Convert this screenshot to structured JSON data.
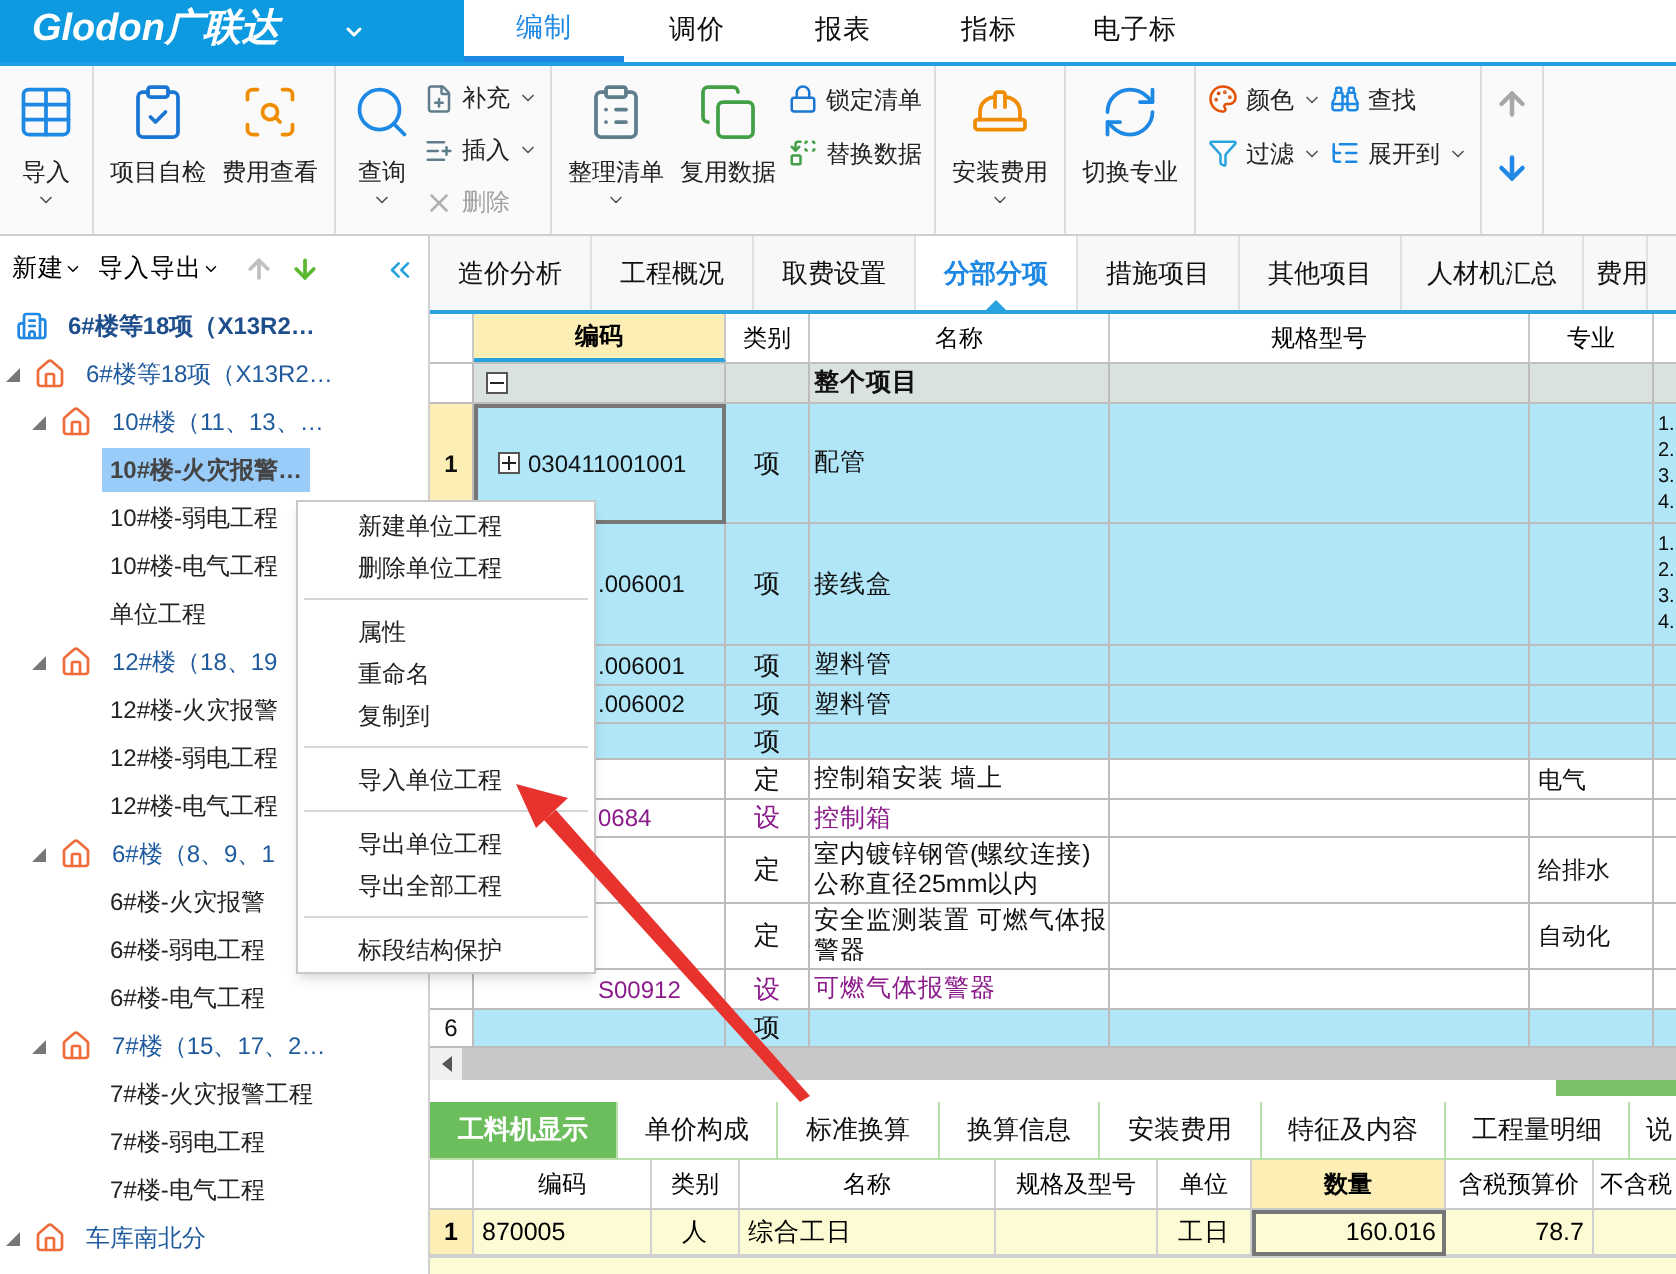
{
  "logo": "Glodon广联达",
  "main_tabs": [
    {
      "label": "编制",
      "selected": true
    },
    {
      "label": "调价",
      "selected": false
    },
    {
      "label": "报表",
      "selected": false
    },
    {
      "label": "指标",
      "selected": false
    },
    {
      "label": "电子标",
      "selected": false
    }
  ],
  "ribbon": {
    "groups": [
      {
        "columns": [
          [
            {
              "kind": "large",
              "label": "导入",
              "dropdown": true,
              "disabled": false
            }
          ]
        ]
      },
      {
        "columns": [
          [
            {
              "kind": "large",
              "label": "项目自检",
              "dropdown": false,
              "disabled": false
            }
          ],
          [
            {
              "kind": "large",
              "label": "费用查看",
              "dropdown": false,
              "disabled": false
            }
          ]
        ]
      },
      {
        "columns": [
          [
            {
              "kind": "large",
              "label": "查询",
              "dropdown": true,
              "disabled": false
            }
          ],
          [
            {
              "kind": "small",
              "label": "补充",
              "dropdown": true,
              "disabled": false
            },
            {
              "kind": "small",
              "label": "插入",
              "dropdown": true,
              "disabled": false
            },
            {
              "kind": "small",
              "label": "删除",
              "dropdown": false,
              "disabled": true
            }
          ]
        ]
      },
      {
        "columns": [
          [
            {
              "kind": "large",
              "label": "整理清单",
              "dropdown": true,
              "disabled": false
            }
          ],
          [
            {
              "kind": "large",
              "label": "复用数据",
              "dropdown": false,
              "disabled": false
            }
          ],
          [
            {
              "kind": "small",
              "label": "锁定清单",
              "dropdown": false,
              "disabled": false
            },
            {
              "kind": "small",
              "label": "替换数据",
              "dropdown": false,
              "disabled": false
            }
          ]
        ]
      },
      {
        "columns": [
          [
            {
              "kind": "large",
              "label": "安装费用",
              "dropdown": true,
              "disabled": false
            }
          ]
        ]
      },
      {
        "columns": [
          [
            {
              "kind": "large",
              "label": "切换专业",
              "dropdown": false,
              "disabled": false
            }
          ]
        ]
      },
      {
        "columns": [
          [
            {
              "kind": "small",
              "label": "颜色",
              "dropdown": true,
              "disabled": false
            },
            {
              "kind": "small",
              "label": "过滤",
              "dropdown": true,
              "disabled": false
            }
          ],
          [
            {
              "kind": "small",
              "label": "查找",
              "dropdown": false,
              "disabled": false
            },
            {
              "kind": "small",
              "label": "展开到",
              "dropdown": true,
              "disabled": false
            }
          ]
        ]
      },
      {
        "columns": [
          [
            {
              "kind": "arrow",
              "disabled": true
            },
            {
              "kind": "arrow",
              "disabled": false
            }
          ]
        ]
      }
    ]
  },
  "left_toolbar": {
    "new": "新建",
    "import_export": "导入导出",
    "move_up_disabled": true,
    "move_down_disabled": false
  },
  "tree": [
    {
      "label": "6#楼等18项（X13R2…",
      "selected": false,
      "children": [
        {
          "label": "6#楼等18项（X13R2…",
          "selected": false,
          "expanded": true,
          "children": [
            {
              "label": "10#楼（11、13、…",
              "selected": false,
              "expanded": true,
              "children": [
                {
                  "label": "10#楼-火灾报警…",
                  "selected": true
                },
                {
                  "label": "10#楼-弱电工程",
                  "selected": false
                },
                {
                  "label": "10#楼-电气工程",
                  "selected": false
                },
                {
                  "label": "单位工程",
                  "selected": false
                }
              ]
            },
            {
              "label": "12#楼（18、19",
              "selected": false,
              "expanded": true,
              "children": [
                {
                  "label": "12#楼-火灾报警",
                  "selected": false
                },
                {
                  "label": "12#楼-弱电工程",
                  "selected": false
                },
                {
                  "label": "12#楼-电气工程",
                  "selected": false
                }
              ]
            },
            {
              "label": "6#楼（8、9、1",
              "selected": false,
              "expanded": true,
              "children": [
                {
                  "label": "6#楼-火灾报警",
                  "selected": false
                },
                {
                  "label": "6#楼-弱电工程",
                  "selected": false
                },
                {
                  "label": "6#楼-电气工程",
                  "selected": false
                }
              ]
            },
            {
              "label": "7#楼（15、17、2…",
              "selected": false,
              "expanded": true,
              "children": [
                {
                  "label": "7#楼-火灾报警工程",
                  "selected": false
                },
                {
                  "label": "7#楼-弱电工程",
                  "selected": false
                },
                {
                  "label": "7#楼-电气工程",
                  "selected": false
                }
              ]
            }
          ]
        },
        {
          "label": "车库南北分",
          "selected": false,
          "expanded": true
        }
      ]
    }
  ],
  "page_tabs": [
    {
      "label": "造价分析",
      "selected": false
    },
    {
      "label": "工程概况",
      "selected": false
    },
    {
      "label": "取费设置",
      "selected": false
    },
    {
      "label": "分部分项",
      "selected": true
    },
    {
      "label": "措施项目",
      "selected": false
    },
    {
      "label": "其他项目",
      "selected": false
    },
    {
      "label": "人材机汇总",
      "selected": false
    },
    {
      "label": "费用",
      "selected": false
    }
  ],
  "grid": {
    "columns": [
      "编码",
      "类别",
      "名称",
      "规格型号",
      "专业"
    ],
    "rows": [
      {
        "kind": "group",
        "name": "整个项目",
        "selected": false
      },
      {
        "kind": "item",
        "num": "1",
        "code": "030411001001",
        "type": "项",
        "name": "配管",
        "extra": "1.\n2.\n3.\n4.",
        "selected": true
      },
      {
        "kind": "item",
        "code": ".006001",
        "type": "项",
        "name": "接线盒",
        "extra": "1.\n2.\n3.\n4.",
        "selected": false
      },
      {
        "kind": "item",
        "code": ".006001",
        "type": "项",
        "name": "塑料管",
        "selected": false
      },
      {
        "kind": "item",
        "code": ".006002",
        "type": "项",
        "name": "塑料管",
        "selected": false
      },
      {
        "kind": "item",
        "type": "项",
        "selected": false
      },
      {
        "kind": "quota",
        "type": "定",
        "name": "控制箱安装 墙上",
        "major": "电气",
        "selected": false
      },
      {
        "kind": "equipment",
        "code": "0684",
        "type": "设",
        "name": "控制箱",
        "selected": false
      },
      {
        "kind": "quota",
        "type": "定",
        "name": "室内镀锌钢管(螺纹连接)\n公称直径25mm以内",
        "major": "给排水",
        "selected": false
      },
      {
        "kind": "quota",
        "type": "定",
        "name": "安全监测装置 可燃气体报警器",
        "major": "自动化",
        "selected": false
      },
      {
        "kind": "equipment",
        "code": "S00912",
        "type": "设",
        "name": "可燃气体报警器",
        "selected": false
      },
      {
        "kind": "item",
        "num": "6",
        "type": "项",
        "selected": false
      }
    ]
  },
  "bottom_tabs": [
    {
      "label": "工料机显示",
      "selected": true
    },
    {
      "label": "单价构成",
      "selected": false
    },
    {
      "label": "标准换算",
      "selected": false
    },
    {
      "label": "换算信息",
      "selected": false
    },
    {
      "label": "安装费用",
      "selected": false
    },
    {
      "label": "特征及内容",
      "selected": false
    },
    {
      "label": "工程量明细",
      "selected": false
    },
    {
      "label": "说",
      "selected": false
    }
  ],
  "bottom_table": {
    "columns": [
      "编码",
      "类别",
      "名称",
      "规格及型号",
      "单位",
      "数量",
      "含税预算价",
      "不含税"
    ],
    "rows": [
      {
        "num": "1",
        "cells": [
          "870005",
          "人",
          "综合工日",
          "",
          "工日",
          "160.016",
          "78.7",
          ""
        ],
        "selected": true
      }
    ]
  },
  "context_menu": {
    "sections": [
      [
        "新建单位工程",
        "删除单位工程"
      ],
      [
        "属性",
        "重命名",
        "复制到"
      ],
      [
        "导入单位工程"
      ],
      [
        "导出单位工程",
        "导出全部工程"
      ],
      [
        "标段结构保护"
      ]
    ]
  }
}
